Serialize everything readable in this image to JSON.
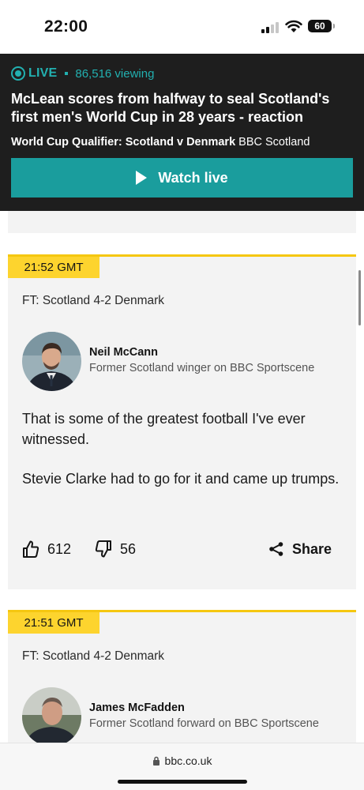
{
  "status_bar": {
    "time": "22:00",
    "battery": "60"
  },
  "live": {
    "label": "LIVE",
    "viewing": "86,516 viewing",
    "headline": "McLean scores from halfway to seal Scotland's first men's World Cup in 28 years - reaction",
    "match_title": "World Cup Qualifier: Scotland v Denmark",
    "broadcaster": "BBC Scotland",
    "watch_label": "Watch live",
    "accent_color": "#1a9d9d"
  },
  "posts": [
    {
      "time": "21:52 GMT",
      "summary": "FT: Scotland 4-2 Denmark",
      "contributor_name": "Neil McCann",
      "contributor_role": "Former Scotland winger on BBC Sportscene",
      "body": [
        "That is some of the greatest football I've ever witnessed.",
        "Stevie Clarke had to go for it and came up trumps."
      ],
      "likes": "612",
      "dislikes": "56",
      "share_label": "Share"
    },
    {
      "time": "21:51 GMT",
      "summary": "FT: Scotland 4-2 Denmark",
      "contributor_name": "James McFadden",
      "contributor_role": "Former Scotland forward on BBC Sportscene"
    }
  ],
  "browser": {
    "url": "bbc.co.uk"
  },
  "icons": [
    "signal-icon",
    "wifi-icon",
    "battery-icon",
    "live-icon",
    "play-icon",
    "thumbs-up-icon",
    "thumbs-down-icon",
    "share-icon",
    "lock-icon"
  ]
}
